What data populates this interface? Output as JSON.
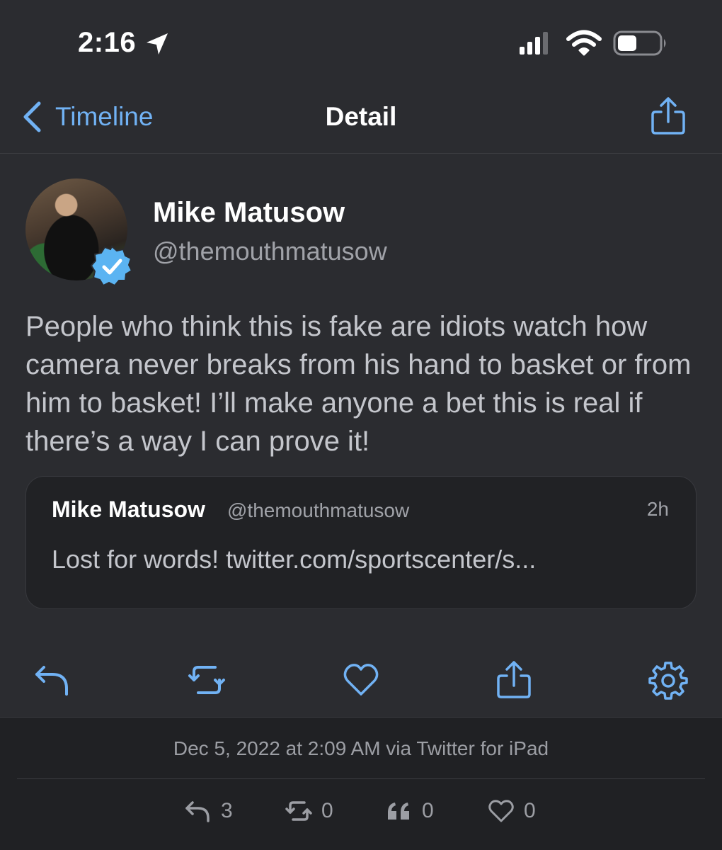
{
  "status_bar": {
    "time": "2:16"
  },
  "nav": {
    "back_label": "Timeline",
    "title": "Detail"
  },
  "tweet": {
    "author_name": "Mike Matusow",
    "author_handle": "@themouthmatusow",
    "text": "People who think this is fake are idiots watch how camera never breaks from his hand to basket or from him to basket! I’ll make anyone a bet this is real if there’s a way I can prove it!",
    "quote": {
      "author_name": "Mike Matusow",
      "author_handle": "@themouthmatusow",
      "age": "2h",
      "text": "Lost for words! twitter.com/sportscenter/s..."
    }
  },
  "actions": [
    "reply-icon",
    "retweet-icon",
    "like-icon",
    "share-icon",
    "gear-icon"
  ],
  "footer": {
    "timestamp": "Dec 5, 2022 at 2:09 AM via Twitter for iPad",
    "stats": {
      "replies": "3",
      "retweets": "0",
      "quotes": "0",
      "likes": "0"
    }
  },
  "colors": {
    "accent": "#71b2f4",
    "background": "#2b2c30",
    "footer": "#202124",
    "verified": "#5bb4f2"
  }
}
